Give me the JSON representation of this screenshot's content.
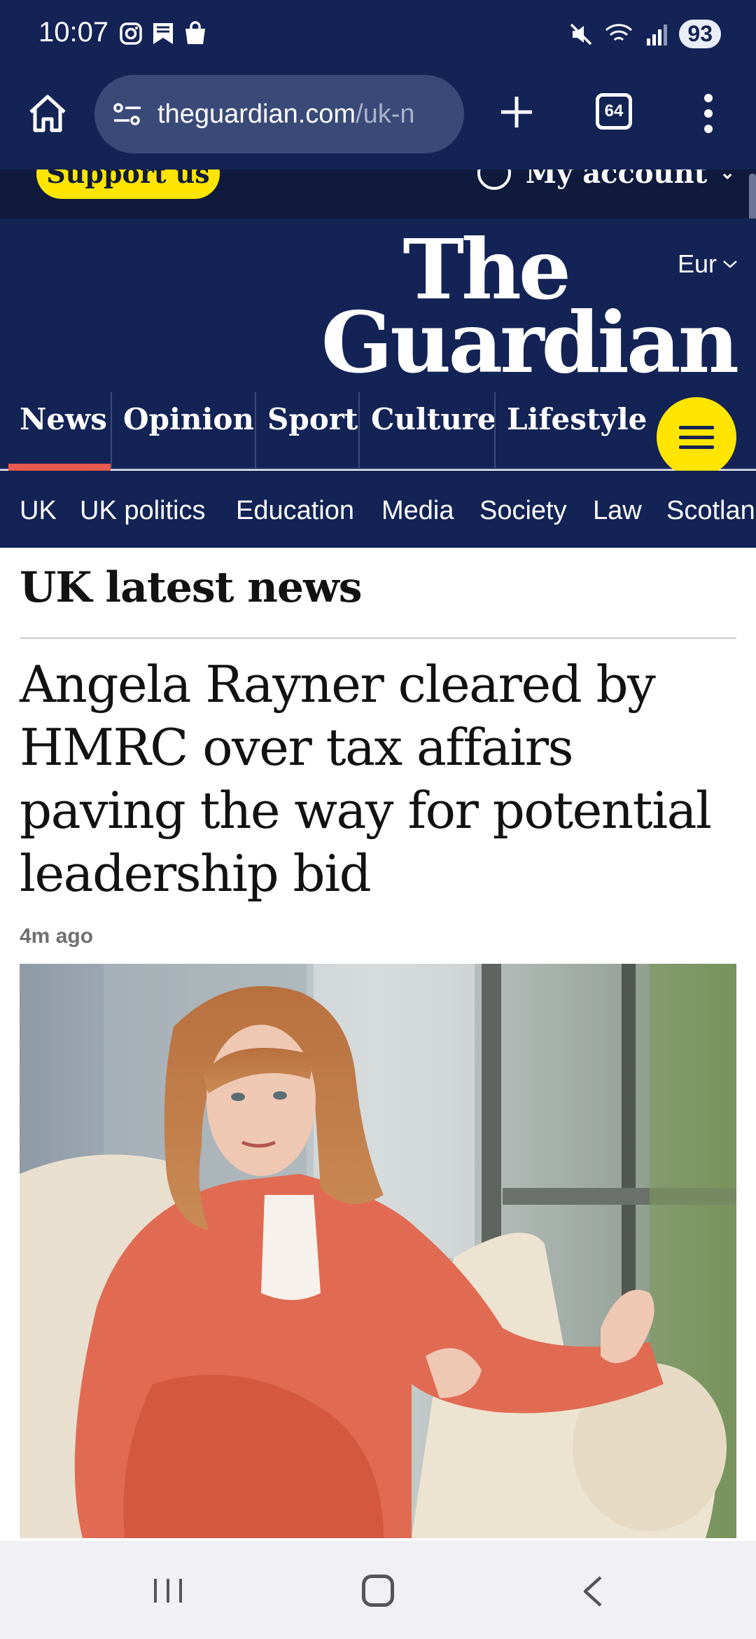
{
  "status_bar": {
    "time": "10:07",
    "battery": "93",
    "left_icons": [
      "instagram-icon",
      "bookmark-icon",
      "shopping-bag-icon"
    ],
    "right_icons": [
      "mute-icon",
      "wifi-icon",
      "signal-icon"
    ]
  },
  "browser": {
    "url_host": "theguardian.com",
    "url_path": "/uk-n",
    "tab_count": "64"
  },
  "header": {
    "support_label": "Support us",
    "account_label": "My account",
    "edition_label": "Eur",
    "logo_line1": "The",
    "logo_line2": "Guardian"
  },
  "pillars": [
    {
      "label": "News",
      "active": true
    },
    {
      "label": "Opinion"
    },
    {
      "label": "Sport"
    },
    {
      "label": "Culture"
    },
    {
      "label": "Lifestyle"
    }
  ],
  "subnav": [
    "UK",
    "UK politics",
    "Education",
    "Media",
    "Society",
    "Law",
    "Scotlan"
  ],
  "main": {
    "section_title": "UK latest news",
    "headline": "Angela Rayner cleared by HMRC over tax affairs paving the way for potential leadership bid",
    "timestamp": "4m ago"
  },
  "colors": {
    "brand_navy": "#132355",
    "accent_yellow": "#ffe500",
    "active_underline": "#e85a4f"
  }
}
